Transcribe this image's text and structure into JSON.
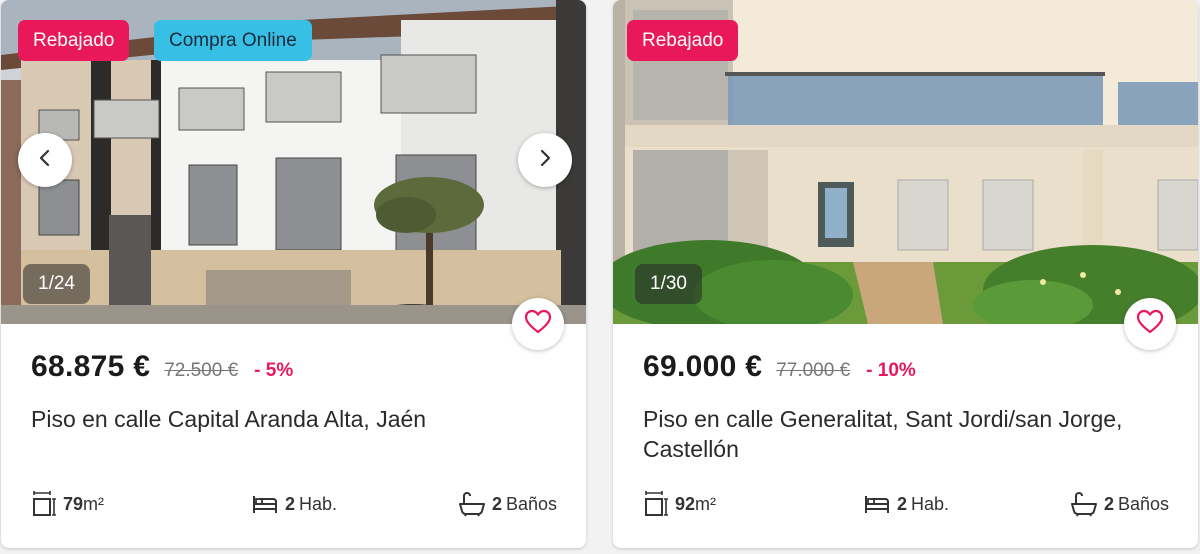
{
  "listings": [
    {
      "badges": [
        "Rebajado",
        "Compra Online"
      ],
      "photo_counter": "1/24",
      "price": "68.875 €",
      "old_price": "72.500 €",
      "discount": "- 5%",
      "title": "Piso en calle Capital Aranda Alta, Jaén",
      "area_value": "79",
      "area_unit": "m²",
      "rooms_value": "2",
      "rooms_unit": "Hab.",
      "baths_value": "2",
      "baths_unit": "Baños"
    },
    {
      "badges": [
        "Rebajado"
      ],
      "photo_counter": "1/30",
      "price": "69.000 €",
      "old_price": "77.000 €",
      "discount": "- 10%",
      "title": "Piso en calle Generalitat, Sant Jordi/san Jorge, Castellón",
      "area_value": "92",
      "area_unit": "m²",
      "rooms_value": "2",
      "rooms_unit": "Hab.",
      "baths_value": "2",
      "baths_unit": "Baños"
    }
  ],
  "colors": {
    "accent": "#e8185b",
    "online_badge": "#38bfe6"
  },
  "icons": [
    "chevron-left-icon",
    "chevron-right-icon",
    "heart-icon",
    "area-icon",
    "bed-icon",
    "bathtub-icon"
  ]
}
